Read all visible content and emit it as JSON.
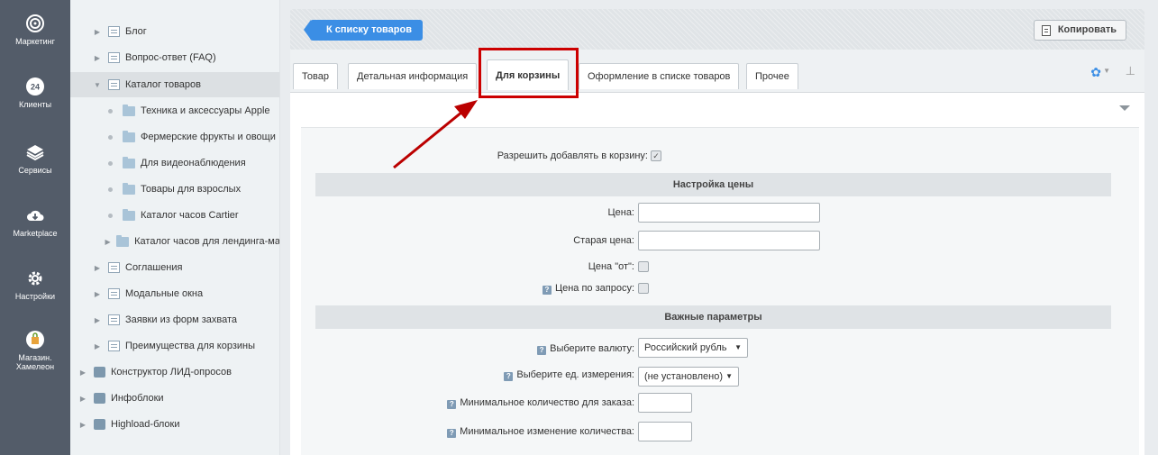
{
  "rail": [
    {
      "label": "Маркетинг",
      "icon": "target-icon"
    },
    {
      "label": "Клиенты",
      "icon": "clients-24-icon"
    },
    {
      "label": "Сервисы",
      "icon": "layers-icon"
    },
    {
      "label": "Marketplace",
      "icon": "cloud-download-icon"
    },
    {
      "label": "Настройки",
      "icon": "gear-icon"
    },
    {
      "label1": "Магазин.",
      "label2": "Хамелеон",
      "icon": "shop-bag-icon"
    }
  ],
  "tree": {
    "items": [
      {
        "label": "Блог"
      },
      {
        "label": "Вопрос-ответ (FAQ)"
      },
      {
        "label": "Каталог товаров"
      },
      {
        "label": "Техника и аксессуары Apple"
      },
      {
        "label": "Фермерские фрукты и овощи"
      },
      {
        "label": "Для видеонаблюдения"
      },
      {
        "label": "Товары для взрослых"
      },
      {
        "label": "Каталог часов Cartier"
      },
      {
        "label": "Каталог часов для лендинга-ма"
      },
      {
        "label": "Соглашения"
      },
      {
        "label": "Модальные окна"
      },
      {
        "label": "Заявки из форм захвата"
      },
      {
        "label": "Преимущества для корзины"
      },
      {
        "label": "Конструктор ЛИД-опросов"
      },
      {
        "label": "Инфоблоки"
      },
      {
        "label": "Highload-блоки"
      }
    ]
  },
  "toolbar": {
    "back_label": "К списку товаров",
    "copy_label": "Копировать"
  },
  "tabs": [
    {
      "label": "Товар"
    },
    {
      "label": "Детальная информация"
    },
    {
      "label": "Для корзины"
    },
    {
      "label": "Оформление в списке товаров"
    },
    {
      "label": "Прочее"
    }
  ],
  "form": {
    "allow_add_label": "Разрешить добавлять в корзину:",
    "allow_add_checked": true,
    "price_section": "Настройка цены",
    "price_label": "Цена:",
    "old_price_label": "Старая цена:",
    "price_from_label": "Цена \"от\":",
    "price_request_label": "Цена по запросу:",
    "important_section": "Важные параметры",
    "currency_label": "Выберите валюту:",
    "currency_value": "Российский рубль",
    "unit_label": "Выберите ед. измерения:",
    "unit_value": "(не установлено)",
    "min_qty_label": "Минимальное количество для заказа:",
    "min_change_label": "Минимальное изменение количества:"
  },
  "colors": {
    "accent": "#3b8ee5",
    "highlight": "#cc0000",
    "rail_bg": "#535c69"
  }
}
